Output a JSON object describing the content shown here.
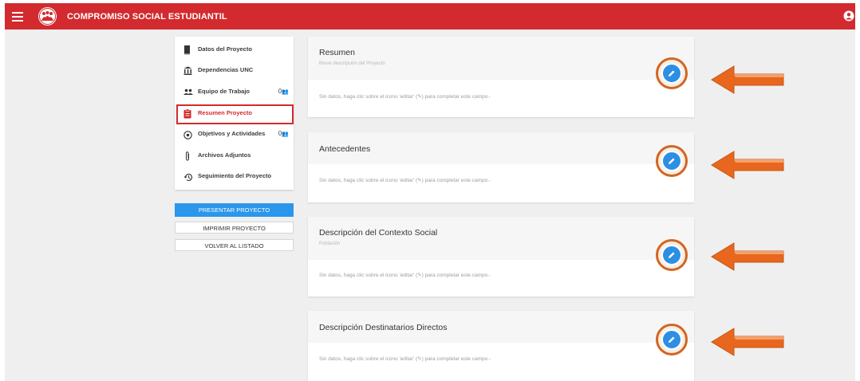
{
  "header": {
    "title": "COMPROMISO SOCIAL ESTUDIANTIL",
    "bg_color": "#d22a2e"
  },
  "sidebar": {
    "items": [
      {
        "label": "Datos del Proyecto",
        "icon": "book-icon",
        "count": ""
      },
      {
        "label": "Dependencias UNC",
        "icon": "institution-icon",
        "count": ""
      },
      {
        "label": "Equipo de Trabajo",
        "icon": "people-icon",
        "count": "0"
      },
      {
        "label": "Resumen Proyecto",
        "icon": "clipboard-icon",
        "count": "",
        "active": true
      },
      {
        "label": "Objetivos y Actividades",
        "icon": "target-icon",
        "count": "0"
      },
      {
        "label": "Archivos Adjuntos",
        "icon": "paperclip-icon",
        "count": ""
      },
      {
        "label": "Seguimiento del Proyecto",
        "icon": "history-icon",
        "count": ""
      }
    ],
    "active_color": "#d22a2e"
  },
  "actions": {
    "present_label": "PRESENTAR PROYECTO",
    "print_label": "IMPRIMIR PROYECTO",
    "back_label": "VOLVER AL LISTADO",
    "primary_color": "#2a97ec"
  },
  "sections": [
    {
      "title": "Resumen",
      "subtitle": "Breve descripción del Proyecto",
      "empty_text": "Sin datos, haga clic sobre el icono 'editar' (✎) para completar este campo.-"
    },
    {
      "title": "Antecedentes",
      "subtitle": "",
      "empty_text": "Sin datos, haga clic sobre el icono 'editar' (✎) para completar este campo.-"
    },
    {
      "title": "Descripción del Contexto Social",
      "subtitle": "Población",
      "empty_text": "Sin datos, haga clic sobre el icono 'editar' (✎) para completar este campo.-"
    },
    {
      "title": "Descripción Destinatarios Directos",
      "subtitle": "",
      "empty_text": "Sin datos, haga clic sobre el icono 'editar' (✎) para completar este campo.-"
    }
  ],
  "annotation": {
    "arrow_color": "#e8661e",
    "highlight_color": "#d5641e"
  }
}
